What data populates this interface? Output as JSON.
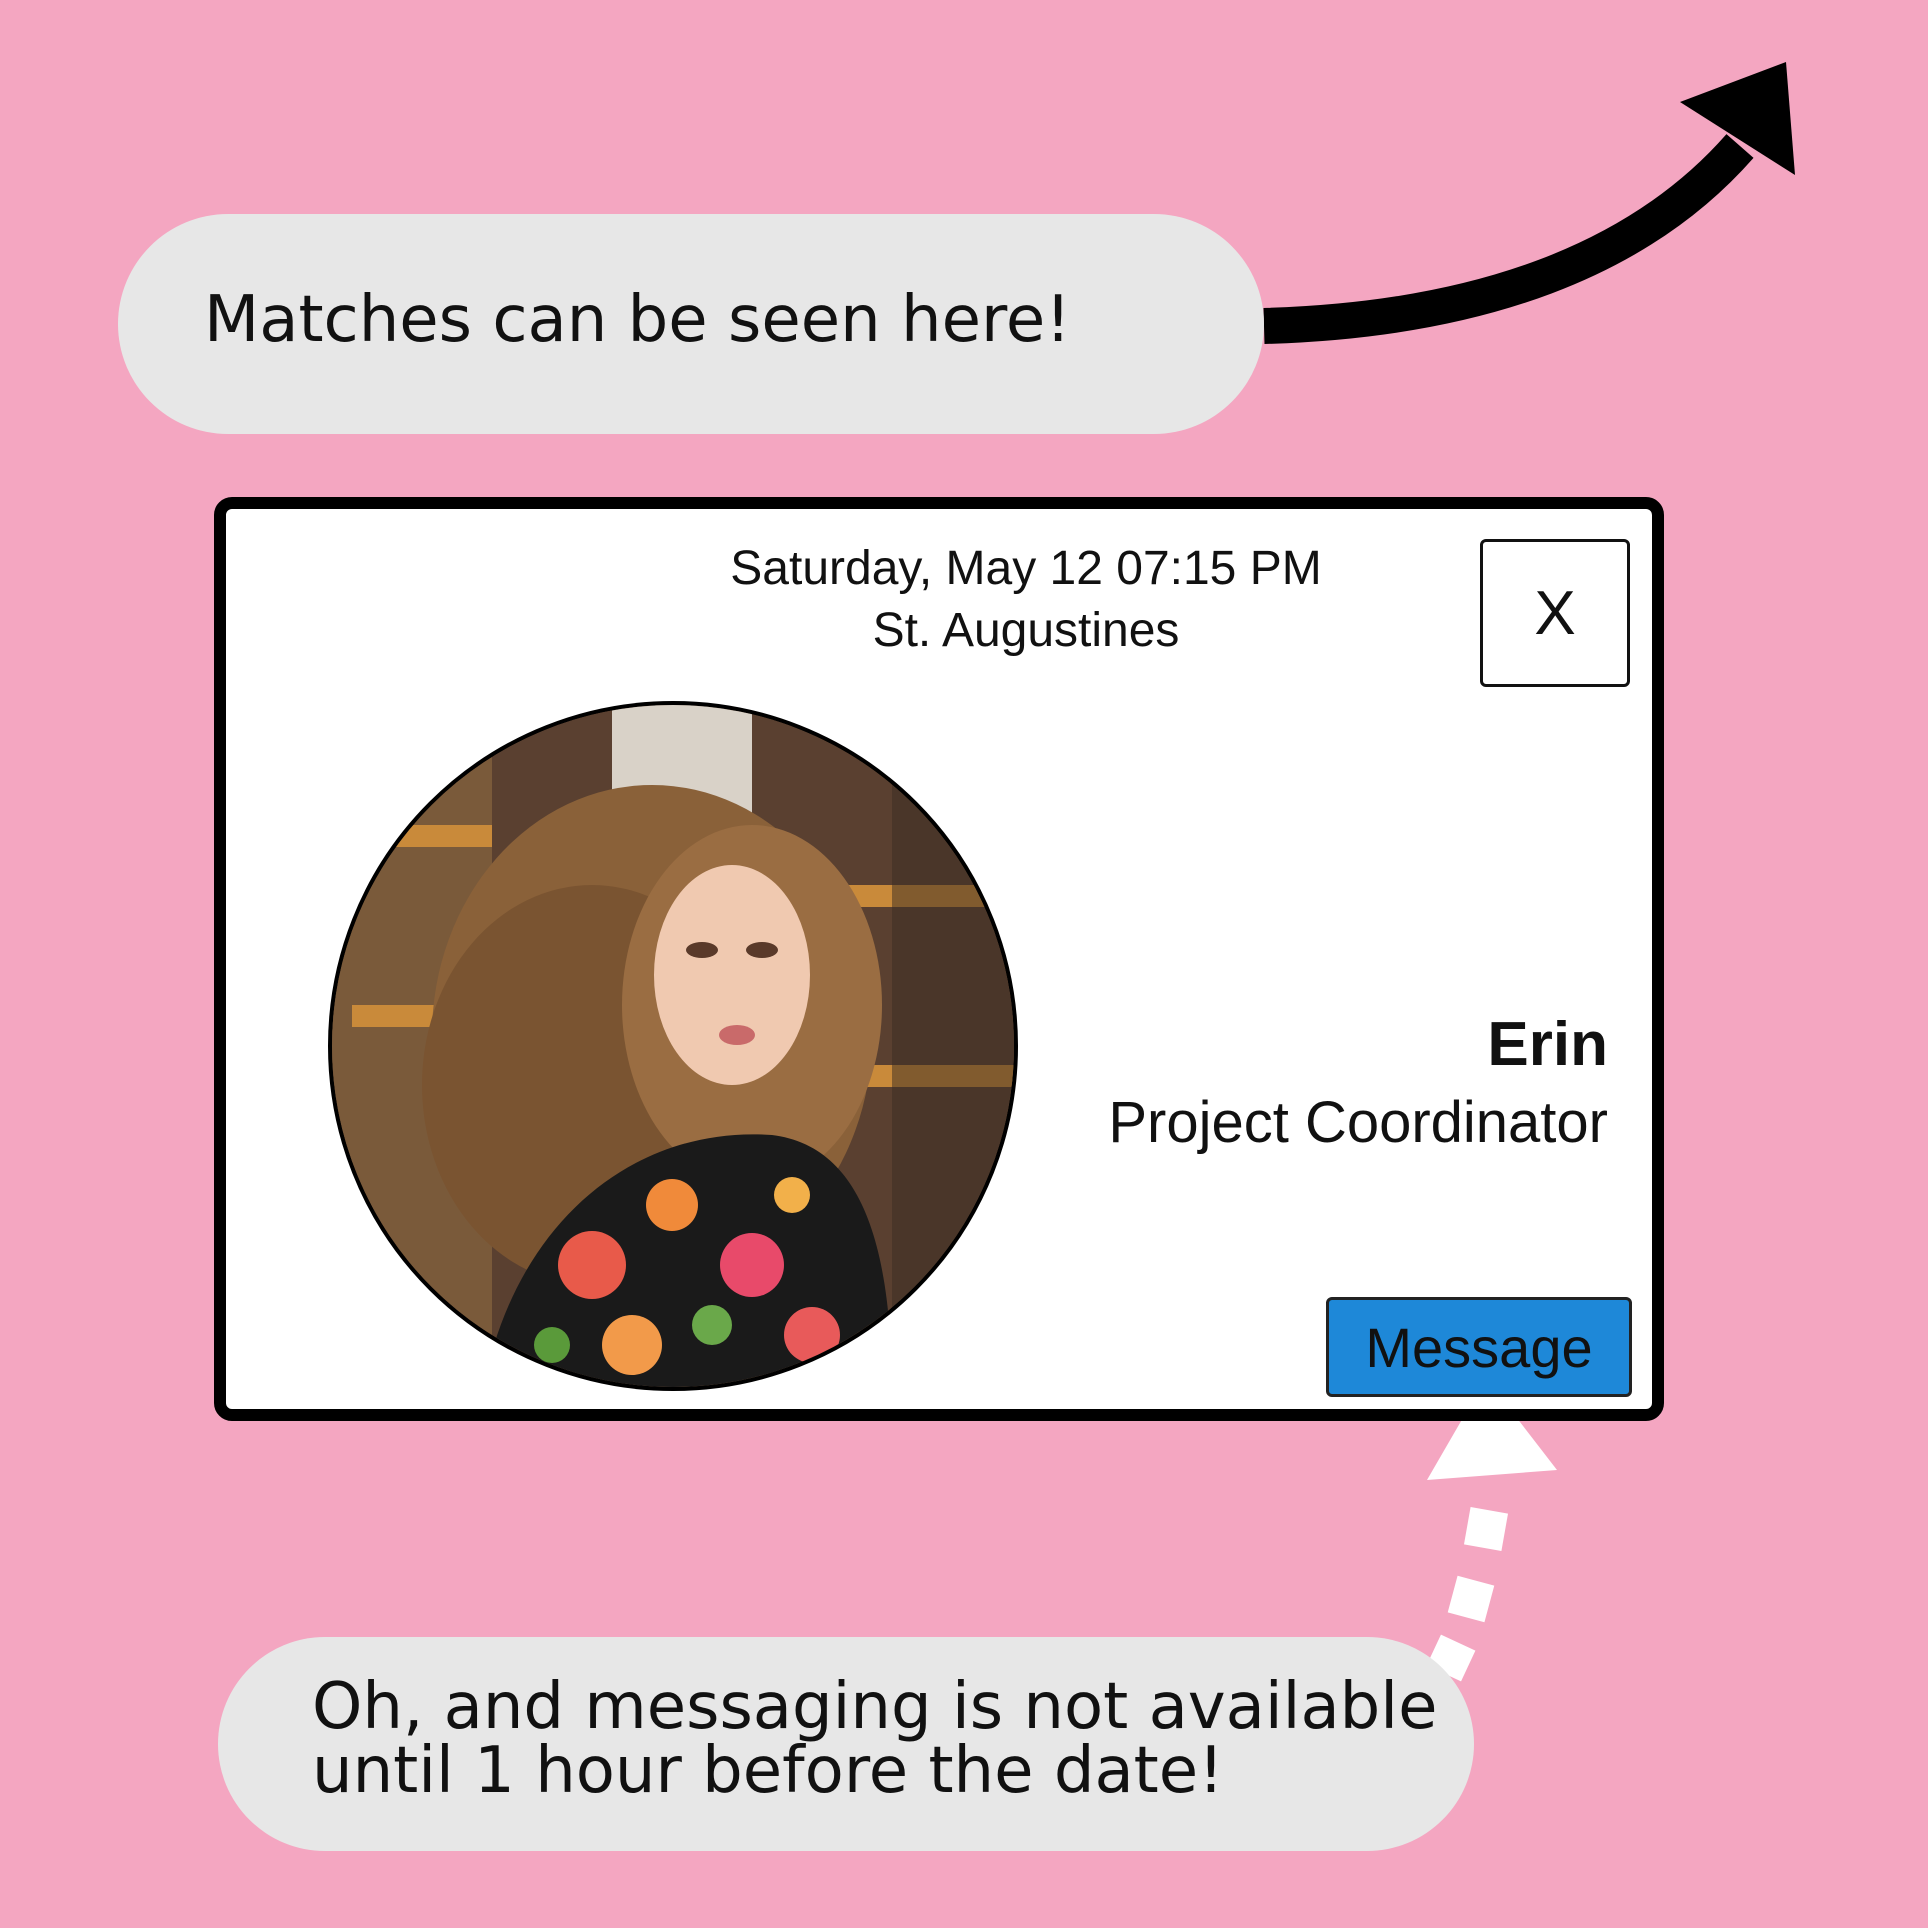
{
  "callouts": {
    "matches_hint": "Matches can be seen here!",
    "messaging_hint_line1": "Oh, and messaging is not available",
    "messaging_hint_line2": "until 1 hour before the date!"
  },
  "match_card": {
    "date_time": "Saturday, May 12 07:15 PM",
    "venue": "St. Augustines",
    "close_label": "X",
    "match_name": "Erin",
    "match_job_title": "Project Coordinator",
    "message_button_label": "Message"
  },
  "colors": {
    "background": "#f4a6c1",
    "bubble": "#e7e7e7",
    "message_button": "#1e88d8",
    "card": "#ffffff"
  },
  "icons": {
    "top_arrow": "curved-arrow-up-right-icon",
    "bottom_arrow": "dotted-arrow-up-icon",
    "close": "x-icon"
  }
}
